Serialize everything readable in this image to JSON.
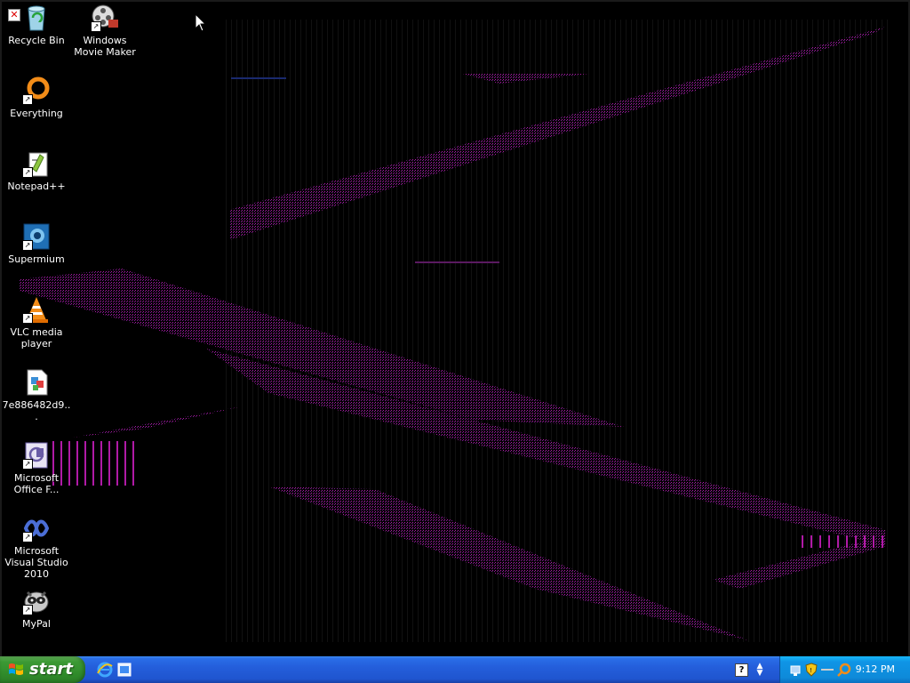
{
  "desktop": {
    "icons": [
      {
        "label": "Recycle Bin",
        "icon": "recycle-bin-icon"
      },
      {
        "label": "Windows Movie Maker",
        "icon": "movie-maker-icon"
      },
      {
        "label": "Everything",
        "icon": "everything-search-icon"
      },
      {
        "label": "Notepad++",
        "icon": "notepad-plus-plus-icon"
      },
      {
        "label": "Supermium",
        "icon": "supermium-browser-icon"
      },
      {
        "label": "VLC media player",
        "icon": "vlc-cone-icon"
      },
      {
        "label": "7e886482d9...",
        "icon": "image-file-icon"
      },
      {
        "label": "Microsoft Office F...",
        "icon": "office-icon"
      },
      {
        "label": "Microsoft Visual Studio 2010",
        "icon": "visual-studio-icon"
      },
      {
        "label": "MyPal",
        "icon": "mypal-browser-icon"
      }
    ]
  },
  "taskbar": {
    "start_label": "start",
    "quick_launch": [
      "internet-explorer-icon",
      "show-desktop-icon"
    ],
    "help_label": "?",
    "clock": "9:12 PM"
  },
  "colors": {
    "desktop_background": "#000000",
    "taskbar_blue": "#245edb",
    "start_green": "#3c9a35",
    "tray_blue": "#0f95e6",
    "artifact_magenta": "#b01aa6"
  }
}
